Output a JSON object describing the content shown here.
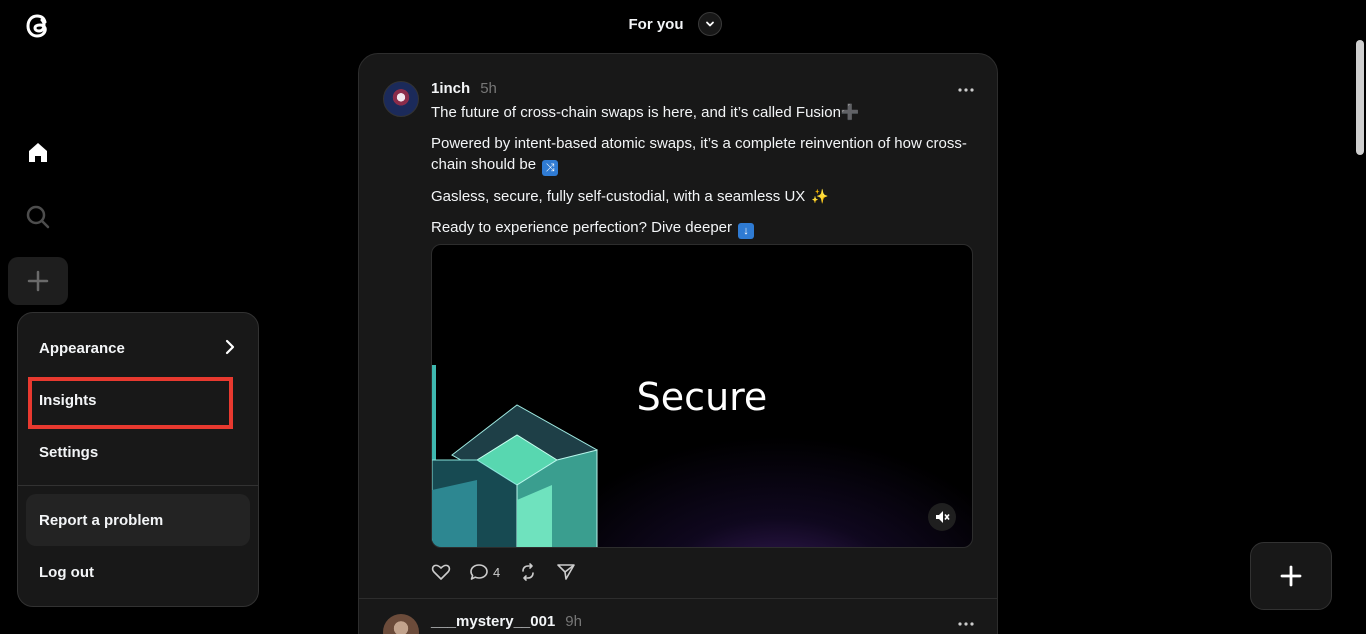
{
  "header": {
    "feed_title": "For you"
  },
  "menu": {
    "appearance": "Appearance",
    "insights": "Insights",
    "settings": "Settings",
    "report": "Report a problem",
    "logout": "Log out"
  },
  "post": {
    "username": "1inch",
    "time": "5h",
    "line1": "The future of cross-chain swaps is here, and it’s called Fusion➕",
    "line2": "Powered by intent-based atomic swaps, it’s a complete reinvention of how cross-chain should be",
    "line3": "Gasless, secure, fully self-custodial, with a seamless UX",
    "line4": "Ready to experience perfection? Dive deeper",
    "media_text": "Secure",
    "reply_count": "4"
  },
  "post2": {
    "username": "___mystery__001",
    "time": "9h"
  },
  "colors": {
    "background": "#000000",
    "surface": "#181818",
    "highlight": "#e8392f",
    "text": "#f3f5f7",
    "muted": "#777777"
  }
}
